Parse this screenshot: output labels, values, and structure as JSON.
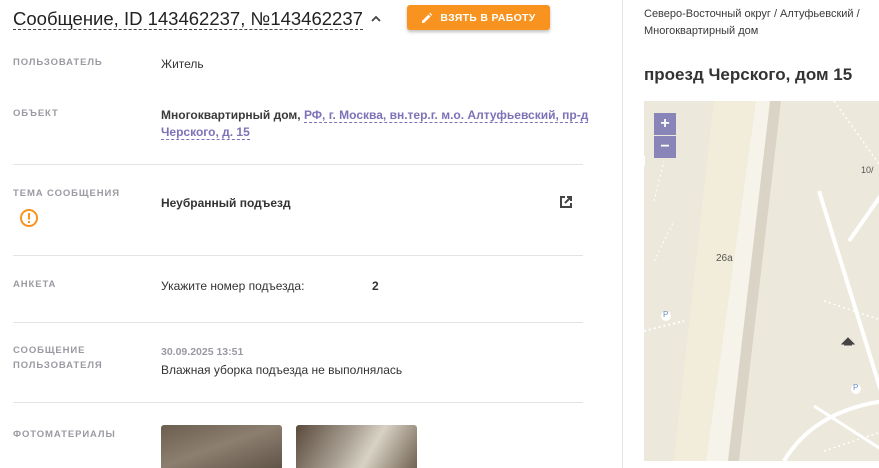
{
  "header": {
    "title": "Сообщение, ID 143462237, №143462237",
    "take_button_label": "ВЗЯТЬ В РАБОТУ"
  },
  "details": {
    "user_label": "ПОЛЬЗОВАТЕЛЬ",
    "user_value": "Житель",
    "object_label": "ОБЪЕКТ",
    "object_type": "Многоквартирный дом,",
    "object_address": "РФ, г. Москва, вн.тер.г. м.о. Алтуфьевский, пр-д Черского, д. 15",
    "topic_label": "ТЕМА СООБЩЕНИЯ",
    "topic_value": "Неубранный подъезд",
    "survey_label": "АНКЕТА",
    "survey_question": "Укажите номер подъезда:",
    "survey_answer": "2",
    "message_label_line1": "СООБЩЕНИЕ",
    "message_label_line2": "ПОЛЬЗОВАТЕЛЯ",
    "message_datetime": "30.09.2025 13:51",
    "message_text": "Влажная уборка подъезда не выполнялась",
    "photos_label": "ФОТОМАТЕРИАЛЫ"
  },
  "side": {
    "breadcrumb_line1": "Северо-Восточный округ / Алтуфьевский /",
    "breadcrumb_line2": "Многоквартирный дом",
    "address_title": "проезд Черского, дом 15"
  },
  "map": {
    "zoom_in": "+",
    "zoom_out": "−",
    "building_label": "26а",
    "corner_label": "10/",
    "parking_label": "P"
  },
  "colors": {
    "accent_orange": "#f7931e",
    "link_purple": "#7d72b8",
    "map_bg": "#ede8dc",
    "zoom_bg": "#8a85b8"
  },
  "icons": [
    "chevron-up-icon",
    "pencil-icon",
    "warning-icon",
    "external-link-icon"
  ]
}
